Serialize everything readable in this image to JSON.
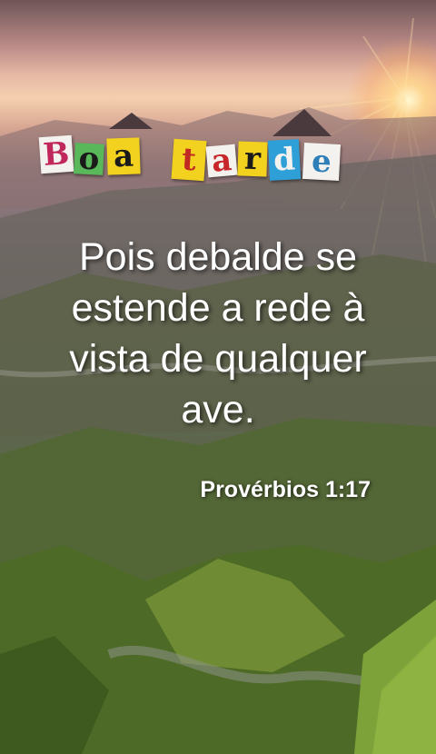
{
  "greeting": {
    "letters": [
      {
        "char": "B",
        "bg": "#f4f2ee",
        "color": "#c0285c"
      },
      {
        "char": "o",
        "bg": "#58b85a",
        "color": "#1a1a1a"
      },
      {
        "char": "a",
        "bg": "#f3d11f",
        "color": "#1a1a1a"
      },
      {
        "char": "t",
        "bg": "#f3d11f",
        "color": "#c02a22"
      },
      {
        "char": "a",
        "bg": "#f4f2ee",
        "color": "#c7262a"
      },
      {
        "char": "r",
        "bg": "#f3d11f",
        "color": "#1a1a1a"
      },
      {
        "char": "d",
        "bg": "#2f9fd8",
        "color": "#f4f2ee"
      },
      {
        "char": "e",
        "bg": "#f4f2ee",
        "color": "#2f7fb8"
      }
    ]
  },
  "quote": {
    "text": "Pois debalde se estende a rede à vista de qualquer ave."
  },
  "reference": {
    "text": "Provérbios 1:17"
  }
}
